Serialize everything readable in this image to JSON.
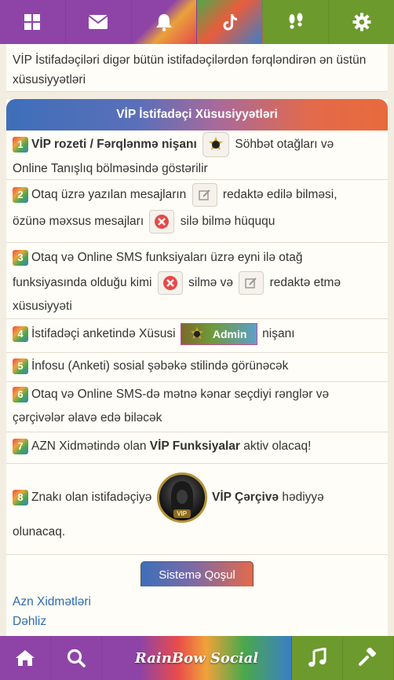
{
  "topnav": {
    "items": [
      {
        "icon": "grid-icon"
      },
      {
        "icon": "mail-icon"
      },
      {
        "icon": "bell-icon"
      },
      {
        "icon": "tiktok-icon"
      },
      {
        "icon": "footprints-icon"
      },
      {
        "icon": "gear-icon"
      }
    ]
  },
  "intro": "VİP İstifadəçiləri digər bütün istifadəçilərdən fərqləndirən ən üstün xüsusiyyətləri",
  "panel": {
    "title": "VİP İstifadəçi Xüsusiyyətləri",
    "items": [
      {
        "num": "1",
        "a": "VİP rozeti / Fərqlənmə nişanı",
        "b": "Söhbət otağları və",
        "c": "Online Tanışlıq bölməsində göstərilir"
      },
      {
        "num": "2",
        "a": "Otaq üzrə yazılan mesajların",
        "b": "redaktə edilə bilməsi,",
        "c": "özünə məxsus mesajları",
        "d": "silə bilmə hüququ"
      },
      {
        "num": "3",
        "a": "Otaq və Online SMS funksiyaları üzrə eyni ilə otağ",
        "b": "funksiyasında olduğu kimi",
        "c": "silmə və",
        "d": "redaktə etmə",
        "e": "xüsusiyyəti"
      },
      {
        "num": "4",
        "a": "İstifadəçi anketində Xüsusi",
        "badge": "Admin",
        "b": "nişanı"
      },
      {
        "num": "5",
        "a": "İnfosu (Anketi) sosial şəbəkə stilində görünəcək"
      },
      {
        "num": "6",
        "a": "Otaq və Online SMS-də mətnə kənar seçdiyi rənglər və",
        "b": "çərçivələr əlavə edə biləcək"
      },
      {
        "num": "7",
        "a": "AZN Xidmətində olan",
        "b": "VİP Funksiyalar",
        "c": "aktiv olacaq!"
      },
      {
        "num": "8",
        "a": "Znakı olan istifadəçiyə",
        "b": "VİP Çərçivə",
        "c": "hədiyyə",
        "d": "olunacaq.",
        "avatar_label": "VIP"
      }
    ],
    "join_label": "Sistemə Qoşul"
  },
  "links": [
    "Azn Xidmətləri",
    "Dəhliz"
  ],
  "bottomnav": {
    "items": [
      {
        "icon": "home-icon"
      },
      {
        "icon": "search-icon"
      },
      {
        "icon": "music-icon"
      },
      {
        "icon": "hammer-icon"
      }
    ],
    "brand": "RainBow Social"
  },
  "colors": {
    "purple": "#8e44a6",
    "green": "#6c9a2c",
    "link": "#2b6cb3",
    "background": "#f3ede1"
  }
}
